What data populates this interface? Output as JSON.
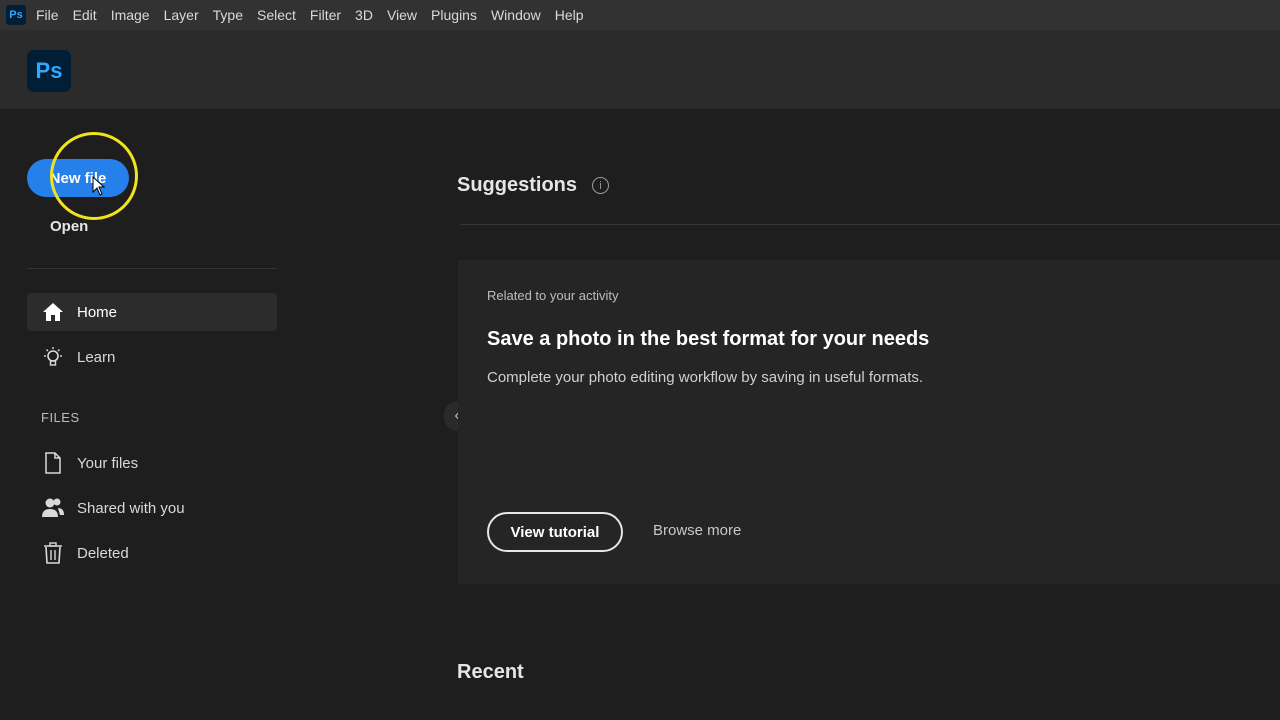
{
  "menubar": {
    "app_icon": "Ps",
    "items": [
      "File",
      "Edit",
      "Image",
      "Layer",
      "Type",
      "Select",
      "Filter",
      "3D",
      "View",
      "Plugins",
      "Window",
      "Help"
    ]
  },
  "toolbar": {
    "logo": "Ps"
  },
  "sidebar": {
    "new_file_label": "New file",
    "open_label": "Open",
    "nav": {
      "home": "Home",
      "learn": "Learn"
    },
    "files_section_label": "FILES",
    "files": {
      "your_files": "Your files",
      "shared": "Shared with you",
      "deleted": "Deleted"
    }
  },
  "suggestions": {
    "title": "Suggestions",
    "info_icon": "i",
    "card": {
      "tag": "Related to your activity",
      "title": "Save a photo in the best format for your needs",
      "description": "Complete your photo editing workflow by saving in useful formats.",
      "primary_button": "View tutorial",
      "secondary_link": "Browse more"
    }
  },
  "recent": {
    "title": "Recent"
  },
  "collapse_handle": "‹",
  "colors": {
    "accent": "#2680eb",
    "highlight_ring": "#f0e41c",
    "ps_blue": "#31a8ff",
    "ps_dark": "#001e36"
  }
}
